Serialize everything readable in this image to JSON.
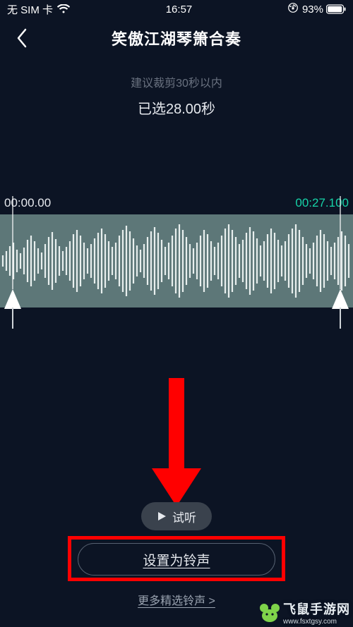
{
  "status_bar": {
    "carrier": "无 SIM 卡",
    "time": "16:57",
    "battery_percent": "93%"
  },
  "nav": {
    "title": "笑傲江湖琴箫合奏"
  },
  "trim": {
    "hint": "建议裁剪30秒以内",
    "selected_label": "已选28.00秒",
    "start_time": "00:00.00",
    "end_time": "00:27.100"
  },
  "actions": {
    "preview_label": "试听",
    "set_ringtone_label": "设置为铃声",
    "more_link_label": "更多精选铃声 >"
  },
  "watermark": {
    "brand": "飞鼠手游网",
    "url": "www.fsxtgsy.com"
  },
  "colors": {
    "bg": "#0c1424",
    "accent": "#16d3a8",
    "muted": "#6a7280",
    "wave_bg": "#5d7778",
    "annotation_red": "#ff0000"
  }
}
